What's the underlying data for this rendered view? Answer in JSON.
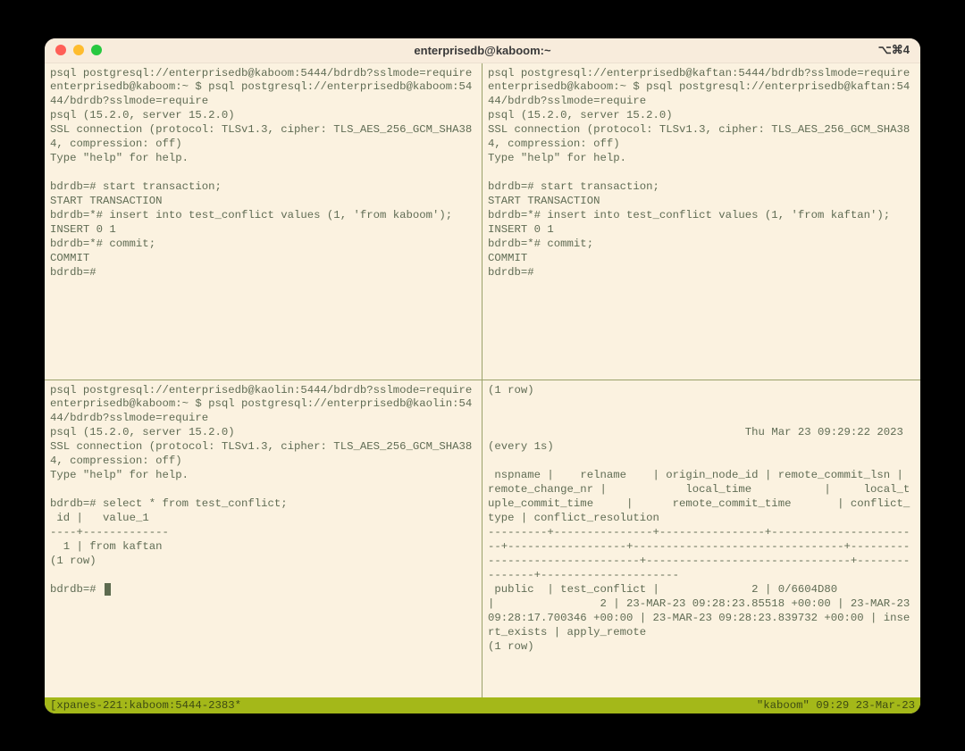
{
  "titlebar": {
    "title": "enterprisedb@kaboom:~",
    "shortcut": "⌥⌘4"
  },
  "panes": {
    "top_left": "psql postgresql://enterprisedb@kaboom:5444/bdrdb?sslmode=require\nenterprisedb@kaboom:~ $ psql postgresql://enterprisedb@kaboom:5444/bdrdb?sslmode=require\npsql (15.2.0, server 15.2.0)\nSSL connection (protocol: TLSv1.3, cipher: TLS_AES_256_GCM_SHA384, compression: off)\nType \"help\" for help.\n\nbdrdb=# start transaction;\nSTART TRANSACTION\nbdrdb=*# insert into test_conflict values (1, 'from kaboom');\nINSERT 0 1\nbdrdb=*# commit;\nCOMMIT\nbdrdb=#",
    "top_right": "psql postgresql://enterprisedb@kaftan:5444/bdrdb?sslmode=require\nenterprisedb@kaboom:~ $ psql postgresql://enterprisedb@kaftan:5444/bdrdb?sslmode=require\npsql (15.2.0, server 15.2.0)\nSSL connection (protocol: TLSv1.3, cipher: TLS_AES_256_GCM_SHA384, compression: off)\nType \"help\" for help.\n\nbdrdb=# start transaction;\nSTART TRANSACTION\nbdrdb=*# insert into test_conflict values (1, 'from kaftan');\nINSERT 0 1\nbdrdb=*# commit;\nCOMMIT\nbdrdb=#",
    "bottom_left": "psql postgresql://enterprisedb@kaolin:5444/bdrdb?sslmode=require\nenterprisedb@kaboom:~ $ psql postgresql://enterprisedb@kaolin:5444/bdrdb?sslmode=require\npsql (15.2.0, server 15.2.0)\nSSL connection (protocol: TLSv1.3, cipher: TLS_AES_256_GCM_SHA384, compression: off)\nType \"help\" for help.\n\nbdrdb=# select * from test_conflict;\n id |   value_1\n----+-------------\n  1 | from kaftan\n(1 row)\n\nbdrdb=# ",
    "bottom_right": "(1 row)\n\n\n                                       Thu Mar 23 09:29:22 2023 (every 1s)\n\n nspname |    relname    | origin_node_id | remote_commit_lsn | remote_change_nr |            local_time           |     local_tuple_commit_time     |      remote_commit_time       | conflict_type | conflict_resolution\n---------+---------------+----------------+-----------------------+------------------+--------------------------------+--------------------------------+-------------------------------+---------------+---------------------\n public  | test_conflict |              2 | 0/6604D80             |                2 | 23-MAR-23 09:28:23.85518 +00:00 | 23-MAR-23 09:28:17.700346 +00:00 | 23-MAR-23 09:28:23.839732 +00:00 | insert_exists | apply_remote\n(1 row)"
  },
  "statusbar": {
    "left": "[xpanes-221:kaboom:5444-2383*",
    "right": "\"kaboom\" 09:29 23-Mar-23"
  }
}
